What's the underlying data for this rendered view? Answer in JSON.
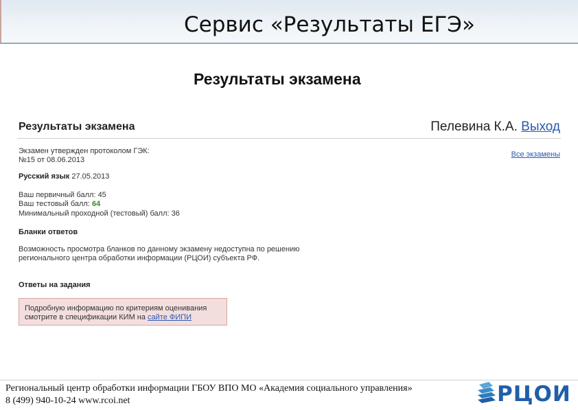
{
  "slide": {
    "title": "Сервис «Результаты ЕГЭ»",
    "subtitle": "Результаты экзамена"
  },
  "screen": {
    "title": "Результаты экзамена",
    "user_name": "Пелевина К.А.",
    "logout_label": "Выход",
    "all_exams_label": "Все экзамены",
    "protocol_line1": "Экзамен утвержден протоколом ГЭК:",
    "protocol_line2": "№15 от 08.06.2013",
    "subject_name": "Русский язык",
    "subject_date": "27.05.2013",
    "primary_score_label": "Ваш первичный балл:",
    "primary_score": "45",
    "test_score_label": "Ваш тестовый балл:",
    "test_score": "64",
    "min_score_label": "Минимальный проходной (тестовый) балл:",
    "min_score": "36",
    "answer_forms_heading": "Бланки ответов",
    "forms_notice_line1": "Возможность просмотра бланков по данному экзамену недоступна по решению",
    "forms_notice_line2": "регионального центра обработки информации (РЦОИ) субъекта РФ.",
    "task_answers_heading": "Ответы на задания",
    "criteria_line1": "Подробную информацию по критериям оценивания",
    "criteria_line2": "смотрите в спецификации КИМ на",
    "fipi_link": "сайте ФИПИ"
  },
  "footer": {
    "line1": "Региональный центр обработки информации ГБОУ ВПО МО «Академия социального управления»",
    "line2": "8 (499) 940-10-24 www.rcoi.net",
    "logo_text": "РЦОИ"
  },
  "colors": {
    "link": "#2a59b0",
    "score_highlight": "#2e8b1e",
    "notice_bg": "#f3dede",
    "logo": "#1f5fa8"
  }
}
